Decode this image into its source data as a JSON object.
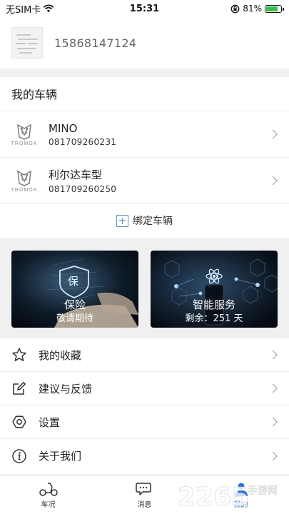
{
  "status_bar": {
    "carrier": "无SIM卡",
    "time": "15:31",
    "battery": "81%",
    "battery_level": 0.81,
    "battery_color": "#3cbf4a"
  },
  "profile": {
    "phone": "15868147124"
  },
  "vehicles": {
    "title": "我的车辆",
    "items": [
      {
        "name": "MINO",
        "id": "081709260231",
        "brand": "TROMOX"
      },
      {
        "name": "利尔达车型",
        "id": "081709260250",
        "brand": "TROMOX"
      }
    ],
    "bind_label": "绑定车辆"
  },
  "cards": [
    {
      "title": "保险",
      "subtitle": "敬请期待",
      "badge": "保"
    },
    {
      "title": "智能服务",
      "subtitle": "剩余：251 天"
    }
  ],
  "menu": [
    {
      "label": "我的收藏",
      "icon": "star-icon"
    },
    {
      "label": "建议与反馈",
      "icon": "edit-icon"
    },
    {
      "label": "设置",
      "icon": "gear-icon"
    },
    {
      "label": "关于我们",
      "icon": "info-icon"
    }
  ],
  "tabs": [
    {
      "label": "车况",
      "icon": "scooter-icon",
      "active": false
    },
    {
      "label": "消息",
      "icon": "chat-icon",
      "active": false
    },
    {
      "label": "我的",
      "icon": "person-icon",
      "active": true
    }
  ],
  "colors": {
    "accent": "#2a6fd6",
    "bind_icon": "#5b8fc7"
  },
  "watermark": {
    "number": "2265",
    "text": "手游网"
  }
}
